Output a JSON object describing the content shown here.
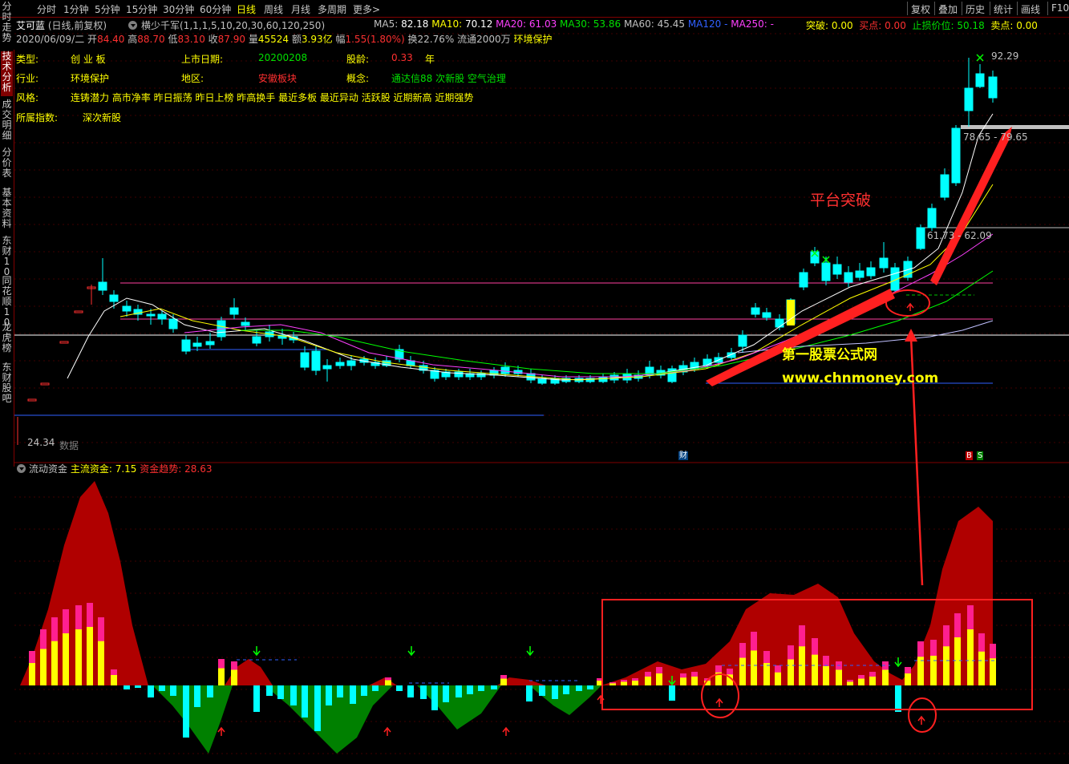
{
  "menu": {
    "left_items": [
      "分时",
      "1分钟",
      "5分钟",
      "15分钟",
      "30分钟",
      "60分钟",
      "日线",
      "周线",
      "月线",
      "多周期",
      "更多>"
    ],
    "active": "日线",
    "right_items": [
      "复权",
      "叠加",
      "历史",
      "统计",
      "画线",
      "F10"
    ]
  },
  "left_tabs": [
    "分时走势",
    "技术分析",
    "成交明细",
    "分价表",
    "基本资料",
    "东财10",
    "同花顺10",
    "龙虎榜",
    "东财股吧"
  ],
  "active_tab": "技术分析",
  "stock": {
    "name": "艾可蓝",
    "mode": "(日线,前复权)",
    "indicator": "横少千军(1,1,1,5,10,20,30,60,120,250)",
    "ma": {
      "ma5_label": "MA5:",
      "ma5": "82.18",
      "ma10_label": "MA10:",
      "ma10": "70.12",
      "ma20_label": "MA20:",
      "ma20": "61.03",
      "ma30_label": "MA30:",
      "ma30": "53.86",
      "ma60_label": "MA60:",
      "ma60": "45.45",
      "ma120_label": "MA120",
      "ma120": "-",
      "ma250_label": "MA250:",
      "ma250": "-"
    },
    "breakout_label": "突破:",
    "breakout": "0.00",
    "buy_label": "买点:",
    "buy": "0.00",
    "stop_label": "止损价位:",
    "stop": "50.18",
    "sell_label": "卖点:",
    "sell": "0.00"
  },
  "quote": {
    "date": "2020/06/09/二",
    "open_label": "开",
    "open": "84.40",
    "high_label": "高",
    "high": "88.70",
    "low_label": "低",
    "low": "83.10",
    "close_label": "收",
    "close": "87.90",
    "vol_label": "量",
    "vol": "45524",
    "amt_label": "额",
    "amt": "3.93亿",
    "chg_label": "幅",
    "chg": "1.55(1.80%)",
    "turn_label": "换",
    "turn": "22.76%",
    "float_label": "流通",
    "float": "2000万",
    "industry": "环境保护"
  },
  "info": {
    "type_label": "类型:",
    "type": "创 业 板",
    "list_label": "上市日期:",
    "list_date": "20200208",
    "age_label": "股龄:",
    "age": "0.33",
    "age_unit": "年",
    "industry_label": "行业:",
    "industry": "环境保护",
    "region_label": "地区:",
    "region": "安徽板块",
    "concept_label": "概念:",
    "concepts": "通达信88  次新股  空气治理",
    "style_label": "风格:",
    "styles": "连铸潜力  高市净率  昨日振荡  昨日上榜  昨高换手  最近多板  最近异动  活跃股  近期新高  近期强势",
    "index_label": "所属指数:",
    "index": "深次新股"
  },
  "price_labels": {
    "high": "92.29",
    "level1": "78.65 - 79.65",
    "level2": "61.73 - 62.09",
    "low": "24.34",
    "nodata": "数据"
  },
  "overlay": {
    "annotation": "平台突破",
    "watermark_cn": "第一股票公式网",
    "watermark_url": "www.chnmoney.com"
  },
  "tags": {
    "cai": "财",
    "b": "B",
    "s": "S"
  },
  "sub": {
    "name": "流动资金",
    "main_label": "主流资金:",
    "main": "7.15",
    "trend_label": "资金趋势:",
    "trend": "28.63"
  },
  "colors": {
    "up": "#ff3030",
    "down": "#00ffff",
    "ma5": "#ffffff",
    "ma10": "#ffff00",
    "ma20": "#ff40ff",
    "ma30": "#00ff00",
    "fund_area": "#b00000",
    "neg_area": "#008000"
  }
}
